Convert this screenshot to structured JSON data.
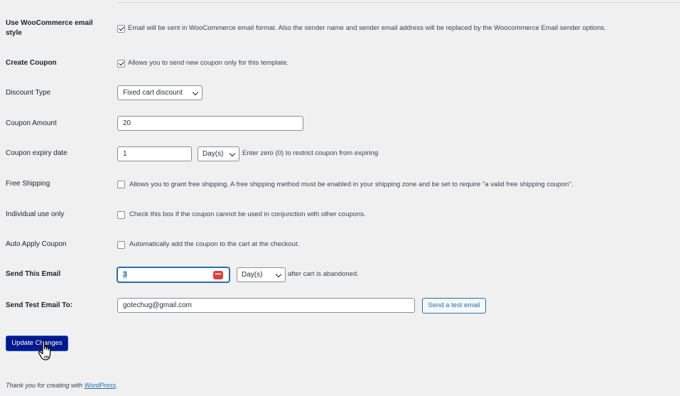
{
  "rows": {
    "wc_style": {
      "label_line1": "Use WooCommerce email",
      "label_line2": "style",
      "desc": "Email will be sent in WooCommerce email format. Also the sender name and sender email address will be replaced by the Woocommerce Email sender options.",
      "checked": true
    },
    "create_coupon": {
      "label": "Create Coupon",
      "desc": "Allows you to send new coupon only for this template.",
      "checked": true
    },
    "discount_type": {
      "label": "Discount Type",
      "value": "Fixed cart discount"
    },
    "coupon_amount": {
      "label": "Coupon Amount",
      "value": "20"
    },
    "coupon_expiry": {
      "label": "Coupon expiry date",
      "value": "1",
      "unit": "Day(s)",
      "desc": "Enter zero (0) to restrict coupon from expiring"
    },
    "free_shipping": {
      "label": "Free Shipping",
      "desc": "Allows you to grant free shipping. A free shipping method must be enabled in your shipping zone and be set to require \"a valid free shipping coupon\".",
      "checked": false
    },
    "individual_use": {
      "label": "Individual use only",
      "desc": "Check this box if the coupon cannot be used in conjunction with other coupons.",
      "checked": false
    },
    "auto_apply": {
      "label": "Auto Apply Coupon",
      "desc": "Automatically add the coupon to the cart at the checkout.",
      "checked": false
    },
    "send_email": {
      "label": "Send This Email",
      "value": "3",
      "unit": "Day(s)",
      "desc": "after cart is abandoned."
    },
    "test_email": {
      "label": "Send Test Email To:",
      "value": "gotechug@gmail.com",
      "button": "Send a test email"
    }
  },
  "update_button": "Update Changes",
  "footer": {
    "text": "Thank you for creating with ",
    "link": "WordPress",
    "suffix": "."
  },
  "icons": {
    "field_extension": "password-manager-icon",
    "cursor": "hand-pointer-icon"
  },
  "colors": {
    "primary_button": "#001a8e",
    "link": "#2271b1",
    "focus": "#2271b1",
    "extension_icon": "#e0403a"
  }
}
